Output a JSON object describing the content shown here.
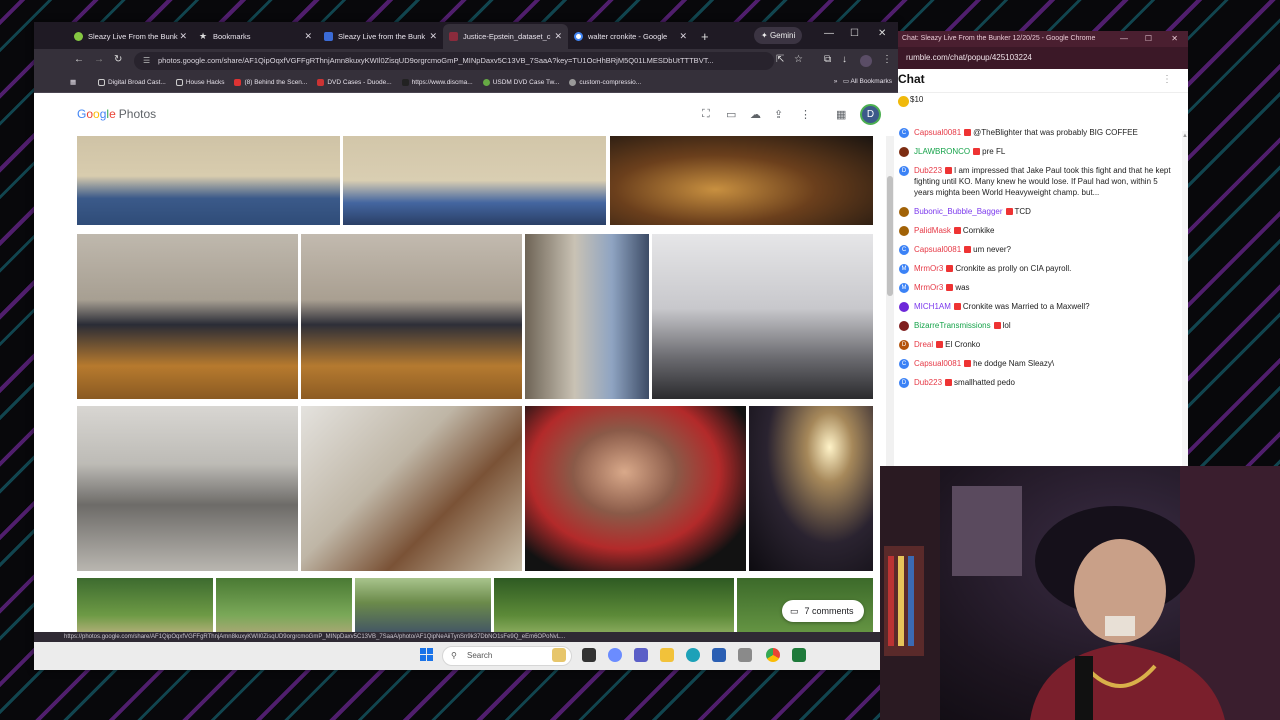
{
  "tabs": [
    {
      "label": "Sleazy Live From the Bunk"
    },
    {
      "label": "Bookmarks"
    },
    {
      "label": "Sleazy Live from the Bunk"
    },
    {
      "label": "Justice-Epstein_dataset_c"
    },
    {
      "label": "walter cronkite - Google"
    }
  ],
  "toolbar": {
    "gemini": "Gemini"
  },
  "address_bar": {
    "url": "photos.google.com/share/AF1QipOqxfVGFFgRThnjAmn8kuxyKWIl0ZisqUD9orgrcmoGmP_MINpDaxv5C13VB_7SaaA?key=TU1OcHhBRjM5Q01LMESDbUtTTTBVT..."
  },
  "bookmarks": [
    "Digital Broad Cast...",
    "House Hacks",
    "(8) Behind the Scen...",
    "DVD Cases - Duode...",
    "https://www.discma...",
    "USDM DVD Case Tw...",
    "custom-compressio..."
  ],
  "all_bookmarks": "All Bookmarks",
  "page": {
    "app_name": "Photos",
    "avatar_initial": "D",
    "comments": "7 comments"
  },
  "status_url": "https://photos.google.com/share/AF1QipOqxfVGFFgRThnjAmn8kuxyKWIl0ZisqUD9orgrcmoGmP_MINpDaxv5C13VB_7SaaA/photo/AF1QipNeAiiTynSn9k37DbNO1sFe9Q_eEm6OPoNvL...",
  "taskbar": {
    "search": "Search"
  },
  "chat": {
    "window_title": "Chat: Sleazy Live From the Bunker 12/20/25 - Google Chrome",
    "url": "rumble.com/chat/popup/425103224",
    "title": "Chat",
    "tip": "$10",
    "messages": [
      {
        "user": "Capsual0081",
        "color": "#e63946",
        "avatar": "#3b82f6",
        "initial": "C",
        "text": "@TheBlighter that was probably BIG COFFEE"
      },
      {
        "user": "JLAWBRONCO",
        "color": "#16a34a",
        "avatar": "#7c2d12",
        "initial": "",
        "text": "pre FL"
      },
      {
        "user": "Dub223",
        "color": "#e63946",
        "avatar": "#3b82f6",
        "initial": "D",
        "text": "I am impressed that Jake Paul took this fight and that he kept fighting until KO. Many knew he would lose. If Paul had won, within 5 years mighta been World Heavyweight champ. but..."
      },
      {
        "user": "Bubonic_Bubble_Bagger",
        "color": "#7c3aed",
        "avatar": "#a16207",
        "initial": "",
        "text": "TCD"
      },
      {
        "user": "PalidMask",
        "color": "#e63946",
        "avatar": "#a16207",
        "initial": "",
        "text": "Cornkike"
      },
      {
        "user": "Capsual0081",
        "color": "#e63946",
        "avatar": "#3b82f6",
        "initial": "C",
        "text": "um never?"
      },
      {
        "user": "MrmOr3",
        "color": "#e63946",
        "avatar": "#3b82f6",
        "initial": "M",
        "text": "Cronkite as prolly on CIA payroll."
      },
      {
        "user": "MrmOr3",
        "color": "#e63946",
        "avatar": "#3b82f6",
        "initial": "M",
        "text": "was"
      },
      {
        "user": "MICH1AM",
        "color": "#7c3aed",
        "avatar": "#6d28d9",
        "initial": "",
        "text": "Cronkite was Married to a Maxwell?"
      },
      {
        "user": "BizarreTransmissions",
        "color": "#16a34a",
        "avatar": "#7f1d1d",
        "initial": "",
        "text": "lol"
      },
      {
        "user": "Dreal",
        "color": "#e63946",
        "avatar": "#b45309",
        "initial": "D",
        "text": "El Cronko"
      },
      {
        "user": "Capsual0081",
        "color": "#e63946",
        "avatar": "#3b82f6",
        "initial": "C",
        "text": "he dodge Nam Sleazy\\"
      },
      {
        "user": "Dub223",
        "color": "#e63946",
        "avatar": "#3b82f6",
        "initial": "D",
        "text": "smallhatted pedo"
      }
    ]
  }
}
